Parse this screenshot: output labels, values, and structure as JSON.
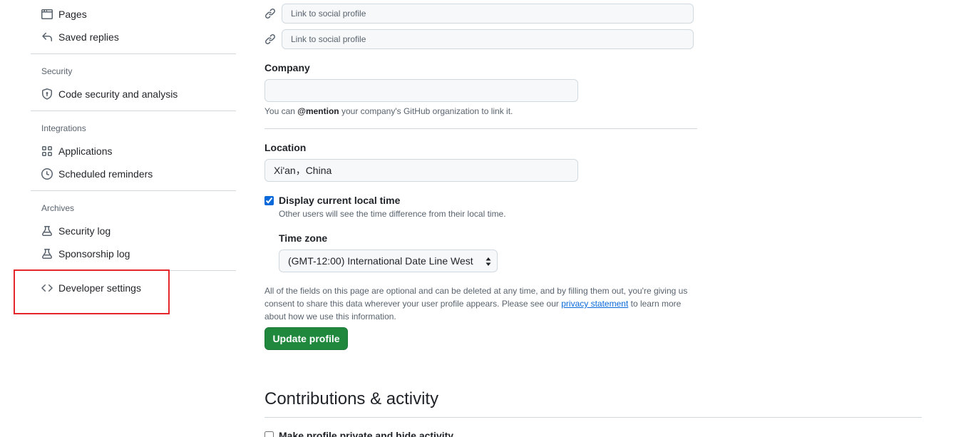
{
  "sidebar": {
    "items_top": [
      {
        "label": "Pages",
        "icon": "browser-icon"
      },
      {
        "label": "Saved replies",
        "icon": "reply-icon"
      }
    ],
    "security": {
      "heading": "Security",
      "items": [
        {
          "label": "Code security and analysis",
          "icon": "shield-lock-icon"
        }
      ]
    },
    "integrations": {
      "heading": "Integrations",
      "items": [
        {
          "label": "Applications",
          "icon": "apps-icon"
        },
        {
          "label": "Scheduled reminders",
          "icon": "clock-icon"
        }
      ]
    },
    "archives": {
      "heading": "Archives",
      "items": [
        {
          "label": "Security log",
          "icon": "log-icon"
        },
        {
          "label": "Sponsorship log",
          "icon": "log-icon"
        }
      ]
    },
    "developer": {
      "label": "Developer settings",
      "icon": "code-icon"
    },
    "highlight_color": "#e5262b"
  },
  "social": {
    "placeholder": "Link to social profile"
  },
  "company": {
    "label": "Company",
    "value": "",
    "note_prefix": "You can ",
    "note_mention": "@mention",
    "note_suffix": " your company's GitHub organization to link it."
  },
  "location": {
    "label": "Location",
    "value": "Xi'an，China"
  },
  "local_time": {
    "checked": true,
    "label": "Display current local time",
    "note": "Other users will see the time difference from their local time."
  },
  "timezone": {
    "label": "Time zone",
    "selected": "(GMT-12:00) International Date Line West"
  },
  "disclaimer": {
    "before": "All of the fields on this page are optional and can be deleted at any time, and by filling them out, you're giving us consent to share this data wherever your user profile appears. Please see our ",
    "link": "privacy statement",
    "after": " to learn more about how we use this information."
  },
  "update_button": "Update profile",
  "contributions": {
    "heading": "Contributions & activity",
    "private_label": "Make profile private and hide activity"
  },
  "colors": {
    "primary_button": "#1f883d",
    "link": "#0969da",
    "muted_text": "#59636e",
    "border": "#d1d9e0"
  }
}
